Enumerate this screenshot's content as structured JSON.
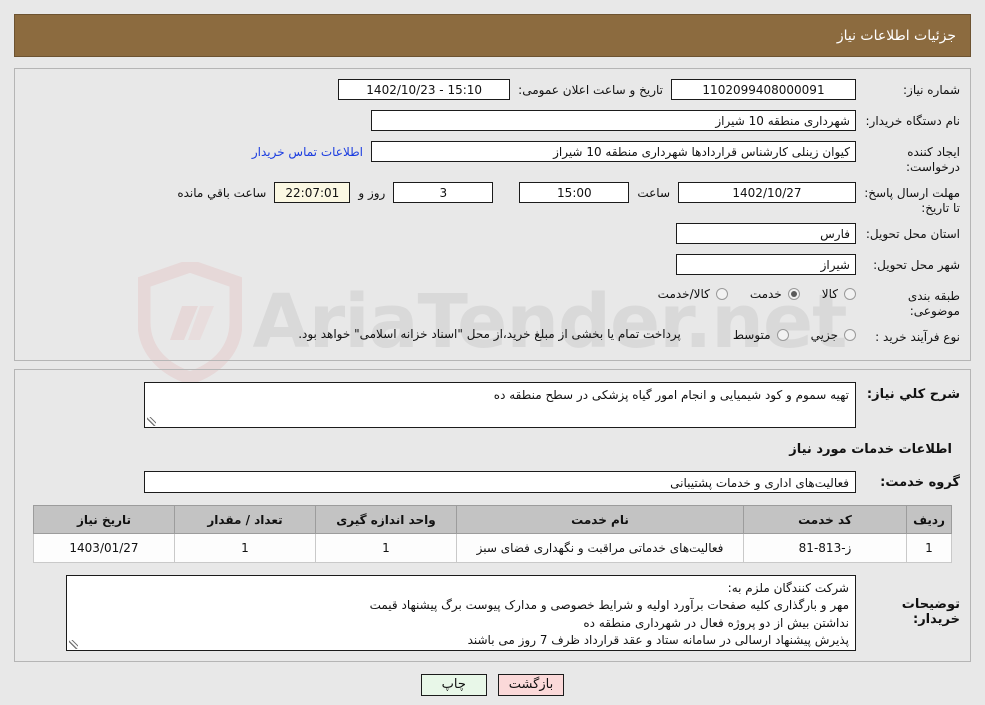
{
  "watermark": {
    "text": "AriaTender.net"
  },
  "header": {
    "title": "جزئیات اطلاعات نیاز"
  },
  "form": {
    "need_number": {
      "label": "شماره نیاز:",
      "value": "1102099408000091"
    },
    "public_announce": {
      "label": "تاریخ و ساعت اعلان عمومی:",
      "value": "15:10 - 1402/10/23"
    },
    "buyer_org": {
      "label": "نام دستگاه خریدار:",
      "value": "شهرداری منطقه 10 شیراز"
    },
    "requester": {
      "label": "ایجاد کننده درخواست:",
      "value": "کیوان زینلی کارشناس قراردادها شهرداری منطقه 10 شیراز",
      "contact_link": "اطلاعات تماس خریدار"
    },
    "deadline": {
      "label": "مهلت ارسال پاسخ: تا تاریخ:",
      "date": "1402/10/27",
      "time_label": "ساعت",
      "time": "15:00",
      "days": "3",
      "days_label": "روز و",
      "counter": "22:07:01",
      "counter_label": "ساعت باقي مانده"
    },
    "province": {
      "label": "استان محل تحویل:",
      "value": "فارس"
    },
    "city": {
      "label": "شهر محل تحویل:",
      "value": "شیراز"
    },
    "category": {
      "label": "طبقه بندی موضوعی:",
      "options": [
        {
          "label": "کالا",
          "checked": false
        },
        {
          "label": "خدمت",
          "checked": true
        },
        {
          "label": "کالا/خدمت",
          "checked": false
        }
      ]
    },
    "process_type": {
      "label": "نوع فرآیند خرید :",
      "options": [
        {
          "label": "جزیي",
          "checked": false
        },
        {
          "label": "متوسط",
          "checked": false
        }
      ],
      "note": "پرداخت تمام یا بخشی از مبلغ خرید،از محل \"اسناد خزانه اسلامی\" خواهد بود."
    }
  },
  "general_desc": {
    "label": "شرح کلي نیاز:",
    "value": "تهیه سموم و کود شیمیایی و انجام امور گیاه پزشکی در سطح منطقه ده"
  },
  "services_section": {
    "title": "اطلاعات خدمات مورد نیاز",
    "service_group": {
      "label": "گروه خدمت:",
      "value": "فعالیت‌های اداری و خدمات پشتیبانی"
    },
    "table": {
      "columns": [
        "ردیف",
        "کد خدمت",
        "نام خدمت",
        "واحد اندازه گیری",
        "تعداد / مقدار",
        "تاریخ نیاز"
      ],
      "rows": [
        {
          "radif": "1",
          "code": "ز-813-81",
          "name": "فعالیت‌های خدماتی مراقبت و نگهداری فضای سبز",
          "unit": "1",
          "qty": "1",
          "date": "1403/01/27"
        }
      ]
    }
  },
  "buyer_notes": {
    "label": "توضیحات خریدار:",
    "lines": [
      "شرکت کنندگان ملزم به:",
      "مهر و بارگذاری کلیه صفحات برآورد اولیه و شرایط خصوصی و مدارک پیوست برگ پیشنهاد قیمت",
      "نداشتن بیش از دو پروژه فعال در شهرداری منطقه ده",
      "پذیرش پیشنهاد ارسالی در سامانه ستاد و عقد قرارداد ظرف 7 روز می باشند"
    ]
  },
  "footer": {
    "print_label": "چاپ",
    "back_label": "بازگشت"
  },
  "colors": {
    "header_brown": "#8c6b3f",
    "link_blue": "#1a3ce0",
    "counter_bg": "#fbf8e3",
    "print_btn": "#e8f7e8",
    "back_btn": "#fbd9d9",
    "table_header": "#c3c3c3",
    "page_bg": "#e8e8e8"
  }
}
